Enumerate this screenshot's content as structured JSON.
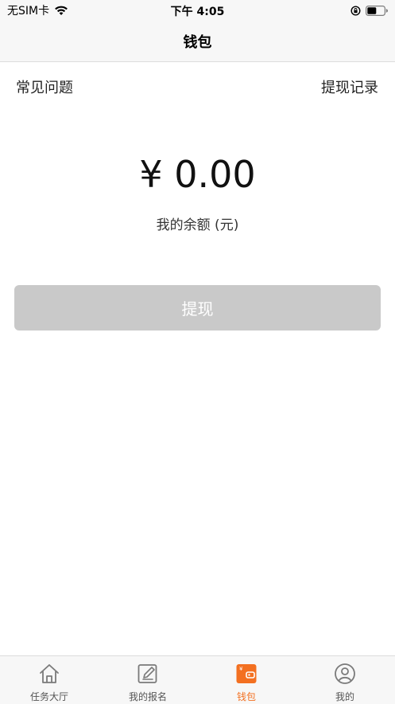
{
  "status_bar": {
    "carrier": "无SIM卡",
    "time": "下午 4:05"
  },
  "nav": {
    "title": "钱包"
  },
  "links": {
    "faq": "常见问题",
    "records": "提现记录"
  },
  "balance": {
    "amount": "¥ 0.00",
    "label": "我的余额 (元)"
  },
  "withdraw_button": {
    "label": "提现"
  },
  "colors": {
    "accent": "#f37021",
    "disabled_button": "#c9c9c9"
  },
  "tabs": [
    {
      "label": "任务大厅",
      "icon": "home-icon",
      "active": false
    },
    {
      "label": "我的报名",
      "icon": "edit-icon",
      "active": false
    },
    {
      "label": "钱包",
      "icon": "wallet-icon",
      "active": true
    },
    {
      "label": "我的",
      "icon": "user-icon",
      "active": false
    }
  ]
}
